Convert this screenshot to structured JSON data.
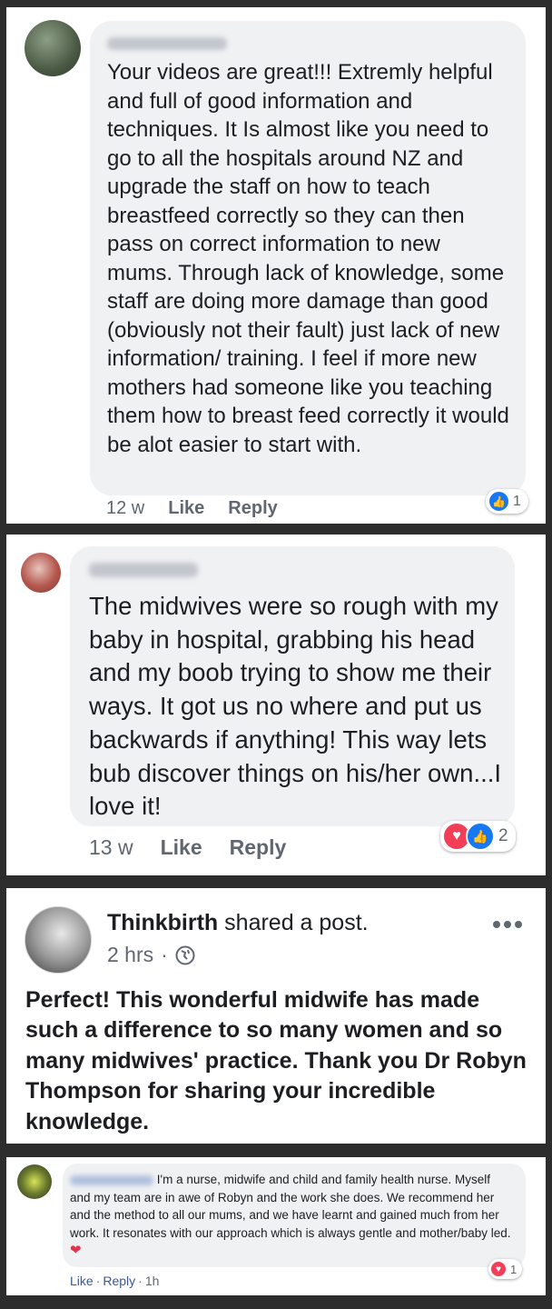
{
  "colors": {
    "like_blue": "#1877f2",
    "love_red": "#f33e58",
    "bubble_bg": "#f0f1f3",
    "meta_grey": "#606770",
    "link_blue": "#385898"
  },
  "comment1": {
    "text": "Your videos are great!!! Extremly helpful and full of good information and techniques. It Is almost like you need to go to all the hospitals around NZ and upgrade the staff on how to teach breastfeed correctly so they can then pass on correct information to new mums. Through lack of knowledge, some staff are doing more damage than good (obviously not their fault) just lack of new information/ training. I feel if more new mothers had someone like you teaching them how to breast feed correctly it would be alot easier to start with.",
    "time": "12 w",
    "like_label": "Like",
    "reply_label": "Reply",
    "reaction_icons": [
      "like-icon"
    ],
    "reaction_count": "1"
  },
  "comment2": {
    "text": "The midwives were so rough with my baby in hospital, grabbing his head and my boob trying to show me their ways. It got us no where and put us backwards if anything! This way lets bub discover things on his/her own...I love it!",
    "time": "13 w",
    "like_label": "Like",
    "reply_label": "Reply",
    "reaction_icons": [
      "love-icon",
      "like-icon"
    ],
    "reaction_count": "2"
  },
  "post": {
    "author": "Thinkbirth",
    "action": "shared a post.",
    "time": "2 hrs",
    "privacy_icon": "globe-icon",
    "more_icon": "more-options-icon",
    "text": "Perfect! This wonderful midwife has made such a difference to so many women and so many midwives' practice. Thank you Dr Robyn Thompson for sharing your incredible knowledge."
  },
  "comment4": {
    "text": "I'm a nurse, midwife and child and family health nurse. Myself and my team are in awe of Robyn and the work she does. We recommend her and the method to all our mums, and we have learnt and gained much from her work. It resonates with our approach which is always gentle and mother/baby led.",
    "emoji": "two-hearts-icon",
    "like_label": "Like",
    "sep": "·",
    "reply_label": "Reply",
    "time": "1h",
    "reaction_icons": [
      "love-icon"
    ],
    "reaction_count": "1"
  }
}
